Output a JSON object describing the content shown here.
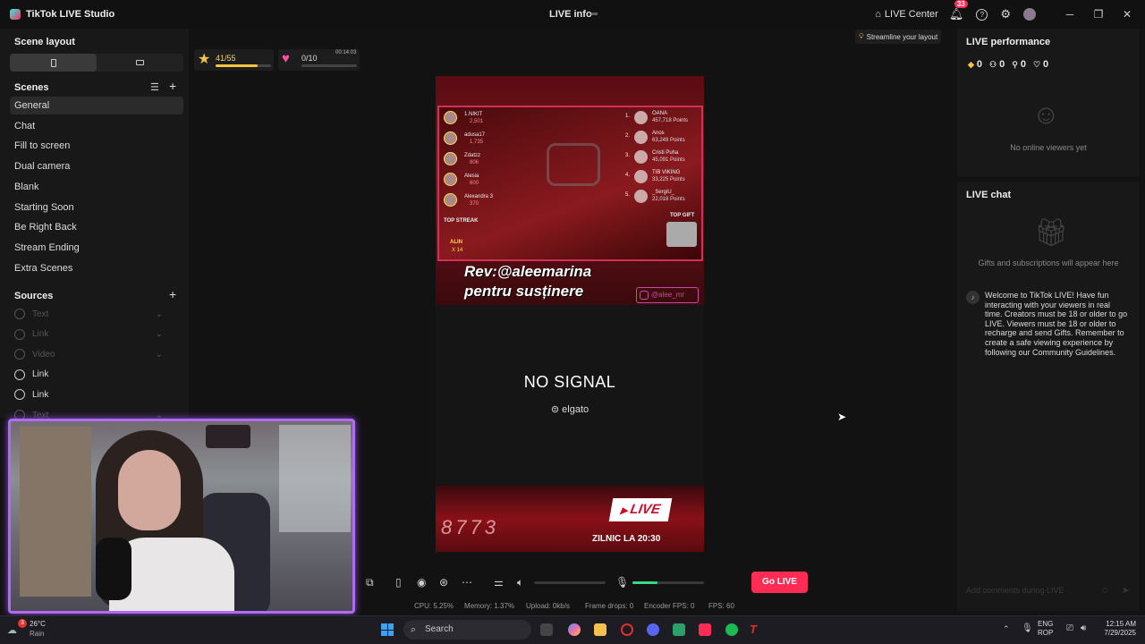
{
  "titlebar": {
    "app_name": "TikTok LIVE Studio",
    "center_title": "LIVE info",
    "live_center": "LIVE Center",
    "notifications_count": "33"
  },
  "left": {
    "scene_layout_title": "Scene layout",
    "scenes_title": "Scenes",
    "scenes": [
      "General",
      "Chat",
      "Fill to screen",
      "Dual camera",
      "Blank",
      "Starting Soon",
      "Be Right Back",
      "Stream Ending",
      "Extra Scenes"
    ],
    "active_scene": "General",
    "sources_title": "Sources",
    "sources": [
      {
        "label": "Text",
        "enabled": false
      },
      {
        "label": "Link",
        "enabled": false
      },
      {
        "label": "Video",
        "enabled": false
      },
      {
        "label": "Link",
        "enabled": true
      },
      {
        "label": "Link",
        "enabled": true
      },
      {
        "label": "Text",
        "enabled": false
      }
    ]
  },
  "widgets": {
    "goal_progress": "41/55",
    "goal_fraction": 0.75,
    "gift_progress": "0/10",
    "gift_timer": "00:14:03"
  },
  "streamline": "Streamline your layout",
  "preview": {
    "leaderboard_left": [
      {
        "name": "1.NIKIT",
        "score": "2,501"
      },
      {
        "name": "adusa17",
        "score": "1,735"
      },
      {
        "name": "Zdatzz",
        "score": "806"
      },
      {
        "name": "Alesia",
        "score": "600"
      },
      {
        "name": "Alexandra 3",
        "score": "370"
      }
    ],
    "leaderboard_right": [
      {
        "rank": "1.",
        "name": "OANA",
        "points": "457,718 Points"
      },
      {
        "rank": "2.",
        "name": "Anos",
        "points": "63,249 Points"
      },
      {
        "rank": "3.",
        "name": "Cristi Puha",
        "points": "45,091 Points"
      },
      {
        "rank": "4.",
        "name": "TIB VIKING",
        "points": "33,225 Points"
      },
      {
        "rank": "5.",
        "name": "_SergiU_",
        "points": "22,018 Points"
      }
    ],
    "top_streak": "TOP STREAK",
    "top_gift": "TOP GIFT",
    "streak_name": "ALIN",
    "streak_count": "X 14",
    "rev_line1": "Rev:@aleemarina",
    "rev_line2": "pentru susținere",
    "instagram_handle": "@alee_mr",
    "no_signal": "NO SIGNAL",
    "brand": "elgato",
    "live_badge": "LIVE",
    "schedule": "ZILNIC LA 20:30",
    "counter": "8773"
  },
  "controls": {
    "go_live": "Go LIVE",
    "volume_fraction": 0.0,
    "mic_fraction": 0.35
  },
  "stats": {
    "cpu": "CPU:  5.25%",
    "memory": "Memory:  1.37%",
    "upload": "Upload:  0kb/s",
    "frame_drops": "Frame drops:  0",
    "encoder_fps": "Encoder FPS:  0",
    "fps": "FPS:  60"
  },
  "right": {
    "perf_title": "LIVE performance",
    "perf": [
      {
        "icon": "diamond-icon",
        "value": "0"
      },
      {
        "icon": "viewers-icon",
        "value": "0"
      },
      {
        "icon": "new-followers-icon",
        "value": "0"
      },
      {
        "icon": "heart-icon",
        "value": "0"
      }
    ],
    "no_viewers": "No online viewers yet",
    "chat_title": "LIVE chat",
    "gifts_placeholder": "Gifts and subscriptions will appear here",
    "welcome_message": "Welcome to TikTok LIVE! Have fun interacting with your viewers in real time. Creators must be 18 or older to go LIVE. Viewers must be 18 or older to recharge and send Gifts. Remember to create a safe viewing experience by following our Community Guidelines.",
    "comment_placeholder": "Add comments during LIVE"
  },
  "taskbar": {
    "weather_temp": "26°C",
    "weather_desc": "Rain",
    "weather_badge": "3",
    "search": "Search",
    "lang1": "ENG",
    "lang2": "ROP",
    "time": "12:15 AM",
    "date": "7/29/2025"
  },
  "colors": {
    "accent": "#fe2c55",
    "webcam_border": "#b06cf0",
    "mic_level": "#39d98a"
  }
}
